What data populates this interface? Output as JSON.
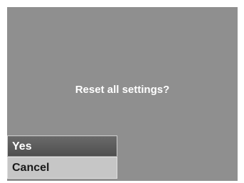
{
  "dialog": {
    "prompt": "Reset all settings?"
  },
  "menu": {
    "items": [
      {
        "label": "Yes",
        "selected": true
      },
      {
        "label": "Cancel",
        "selected": false
      }
    ]
  },
  "colors": {
    "background": "#8f8f8f",
    "selected_item": "#5a5a5a",
    "unselected_item": "#c6c6c6",
    "prompt_text": "#ffffff"
  }
}
